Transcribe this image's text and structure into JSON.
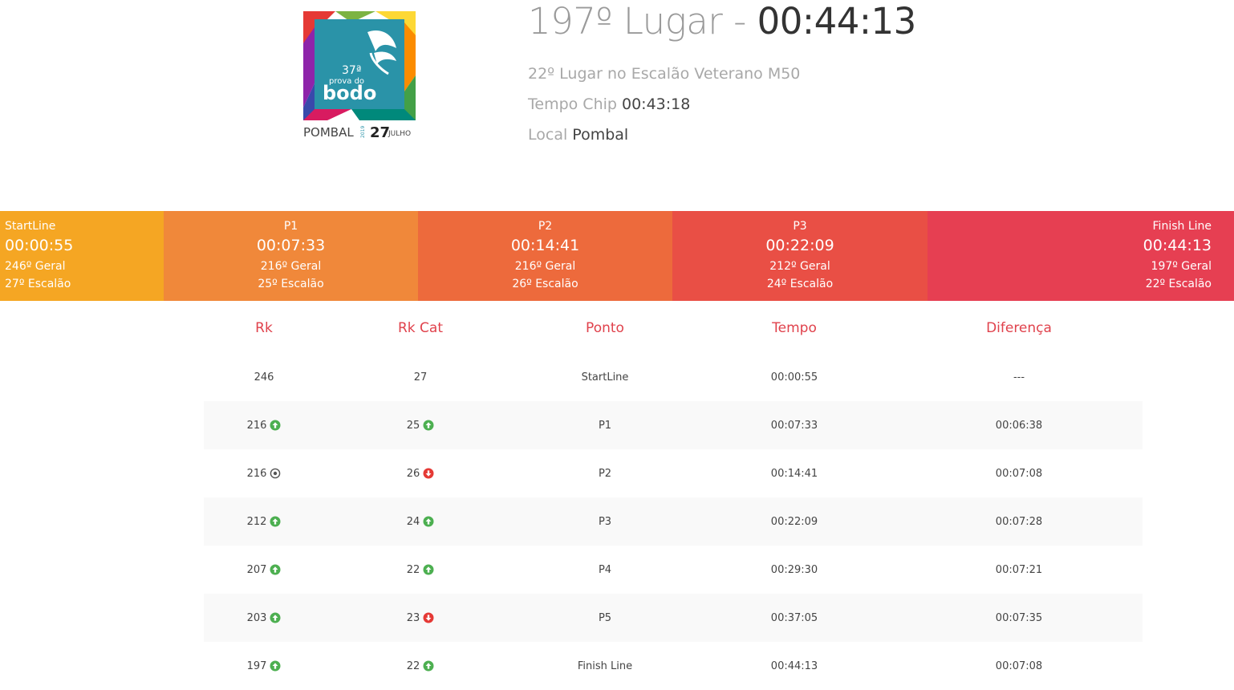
{
  "header": {
    "position_label": "197º Lugar -",
    "final_time": "00:44:13",
    "category_rank": "22º Lugar no Escalão Veterano M50",
    "chip_label": "Tempo Chip",
    "chip_time": "00:43:18",
    "local_label": "Local",
    "local_value": "Pombal"
  },
  "logo": {
    "edition": "37ª",
    "line1": "prova do",
    "line2": "bodo",
    "city": "POMBAL",
    "year": "2019",
    "day": "27",
    "month": "JULHO"
  },
  "splits": [
    {
      "label": "StartLine",
      "time": "00:00:55",
      "overall": "246º Geral",
      "category": "27º Escalão",
      "color": "#f5a623"
    },
    {
      "label": "P1",
      "time": "00:07:33",
      "overall": "216º Geral",
      "category": "25º Escalão",
      "color": "#f0883a"
    },
    {
      "label": "P2",
      "time": "00:14:41",
      "overall": "216º Geral",
      "category": "26º Escalão",
      "color": "#ed6a3c"
    },
    {
      "label": "P3",
      "time": "00:22:09",
      "overall": "212º Geral",
      "category": "24º Escalão",
      "color": "#e94f45"
    },
    {
      "label": "Finish Line",
      "time": "00:44:13",
      "overall": "197º Geral",
      "category": "22º Escalão",
      "color": "#e63f52"
    }
  ],
  "table": {
    "headers": [
      "Rk",
      "Rk Cat",
      "Ponto",
      "Tempo",
      "Diferença"
    ],
    "rows": [
      {
        "rk": "246",
        "rk_icon": "",
        "rkcat": "27",
        "rkcat_icon": "",
        "point": "StartLine",
        "time": "00:00:55",
        "diff": "---"
      },
      {
        "rk": "216",
        "rk_icon": "up",
        "rkcat": "25",
        "rkcat_icon": "up",
        "point": "P1",
        "time": "00:07:33",
        "diff": "00:06:38"
      },
      {
        "rk": "216",
        "rk_icon": "same",
        "rkcat": "26",
        "rkcat_icon": "down",
        "point": "P2",
        "time": "00:14:41",
        "diff": "00:07:08"
      },
      {
        "rk": "212",
        "rk_icon": "up",
        "rkcat": "24",
        "rkcat_icon": "up",
        "point": "P3",
        "time": "00:22:09",
        "diff": "00:07:28"
      },
      {
        "rk": "207",
        "rk_icon": "up",
        "rkcat": "22",
        "rkcat_icon": "up",
        "point": "P4",
        "time": "00:29:30",
        "diff": "00:07:21"
      },
      {
        "rk": "203",
        "rk_icon": "up",
        "rkcat": "23",
        "rkcat_icon": "down",
        "point": "P5",
        "time": "00:37:05",
        "diff": "00:07:35"
      },
      {
        "rk": "197",
        "rk_icon": "up",
        "rkcat": "22",
        "rkcat_icon": "up",
        "point": "Finish Line",
        "time": "00:44:13",
        "diff": "00:07:08"
      }
    ]
  },
  "colors": {
    "up": "#4caf50",
    "down": "#e53935",
    "same": "#555555",
    "header_text": "#e0424c"
  }
}
